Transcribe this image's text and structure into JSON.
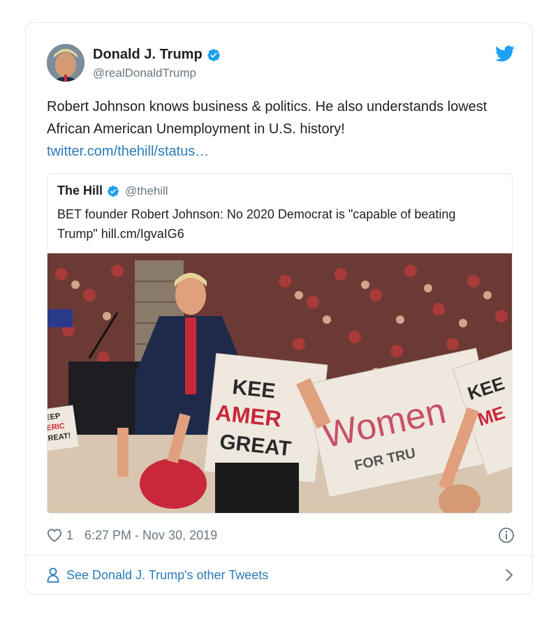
{
  "tweet": {
    "author": {
      "name": "Donald J. Trump",
      "handle": "@realDonaldTrump"
    },
    "text": "Robert Johnson knows business & politics. He also understands lowest African American Unemployment in U.S. history!",
    "link_text": "twitter.com/thehill/status…",
    "quoted": {
      "name": "The Hill",
      "handle": "@thehill",
      "text": "BET founder Robert Johnson: No 2020 Democrat is \"capable of beating Trump\" hill.cm/IgvaIG6",
      "media": {
        "sign_keep_america_great": [
          "KEE",
          "AMER",
          "GREAT"
        ],
        "sign_women_for_trump": [
          "Women",
          "FOR TRU"
        ],
        "sign_left_edge": [
          "EEP",
          "ERIC",
          "REAT!"
        ],
        "sign_right_edge": [
          "KEE",
          "ME"
        ]
      }
    },
    "likes": "1",
    "timestamp": "6:27 PM - Nov 30, 2019",
    "footer_link": "See Donald J. Trump's other Tweets"
  },
  "colors": {
    "link": "#2b7bb9",
    "verified": "#1da1f2",
    "muted": "#697882",
    "border": "#e1e8ed"
  },
  "icons": [
    "verified-badge-icon",
    "twitter-bird-icon",
    "heart-icon",
    "info-icon",
    "person-icon",
    "chevron-right-icon"
  ]
}
